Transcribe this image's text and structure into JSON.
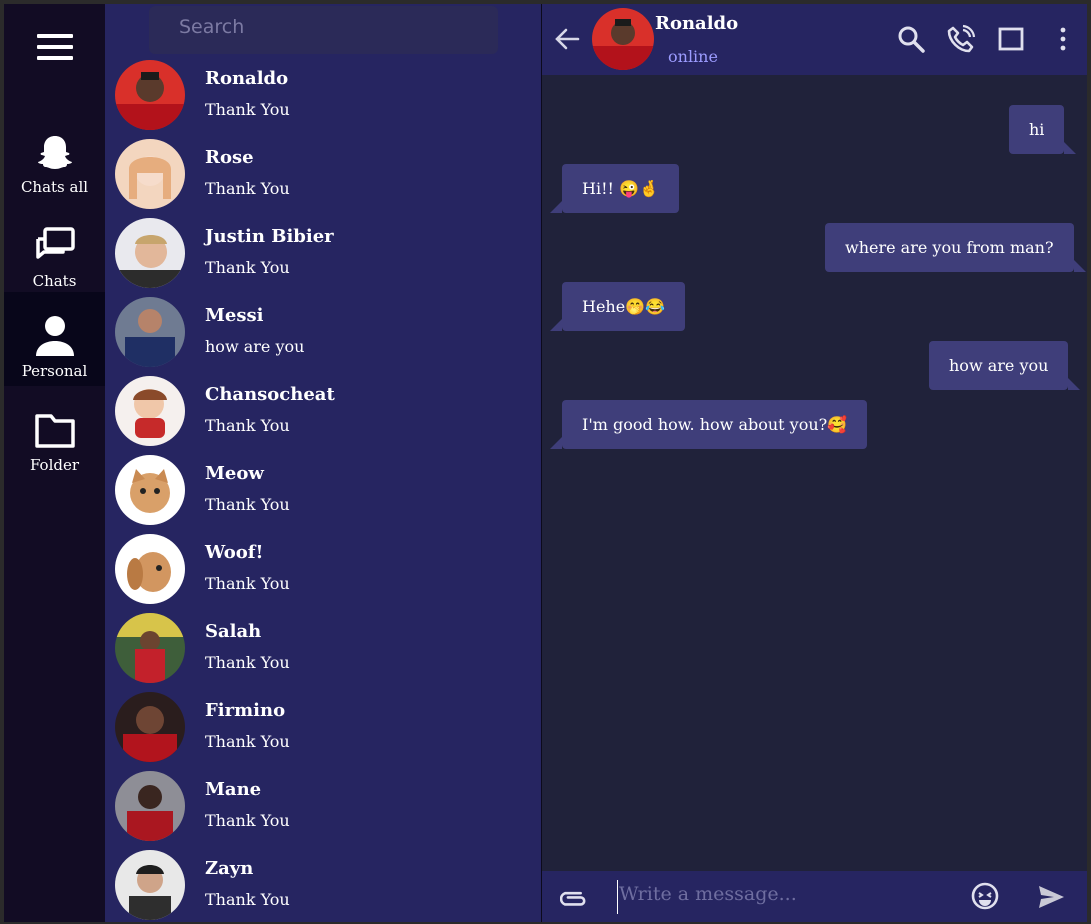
{
  "sidebar": {
    "items": [
      {
        "label": "Chats all",
        "icon": "snapchat-ghost-icon",
        "active": false
      },
      {
        "label": "Chats",
        "icon": "chat-bubbles-icon",
        "active": false
      },
      {
        "label": "Personal",
        "icon": "person-icon",
        "active": true
      },
      {
        "label": "Folder",
        "icon": "folder-icon",
        "active": false
      }
    ]
  },
  "search": {
    "placeholder": "Search"
  },
  "chats": [
    {
      "name": "Ronaldo",
      "last": "Thank You",
      "avatar": "#b3121b"
    },
    {
      "name": "Rose",
      "last": "Thank You",
      "avatar": "#e8b48a"
    },
    {
      "name": "Justin Bibier",
      "last": "Thank You",
      "avatar": "#c5b7a8"
    },
    {
      "name": "Messi",
      "last": "how are you",
      "avatar": "#243a73"
    },
    {
      "name": "Chansocheat",
      "last": "Thank You",
      "avatar": "#f2ece9"
    },
    {
      "name": "Meow",
      "last": "Thank You",
      "avatar": "#d6a06a"
    },
    {
      "name": "Woof!",
      "last": "Thank You",
      "avatar": "#c88a4f"
    },
    {
      "name": "Salah",
      "last": "Thank You",
      "avatar": "#c3212b"
    },
    {
      "name": "Firmino",
      "last": "Thank You",
      "avatar": "#b2141d"
    },
    {
      "name": "Mane",
      "last": "Thank You",
      "avatar": "#aa1720"
    },
    {
      "name": "Zayn",
      "last": "Thank You",
      "avatar": "#3a3a3a"
    }
  ],
  "conversation": {
    "name": "Ronaldo",
    "status": "online",
    "messages": [
      {
        "from": "me",
        "text": "hi"
      },
      {
        "from": "them",
        "text": "Hi!! 😜🤞"
      },
      {
        "from": "me",
        "text": "where are you from man?"
      },
      {
        "from": "them",
        "text": "Hehe🤭😂"
      },
      {
        "from": "me",
        "text": "how are you"
      },
      {
        "from": "them",
        "text": "I'm good how. how about you?🥰"
      }
    ]
  },
  "composer": {
    "placeholder": "Write a message..."
  },
  "colors": {
    "rail": "#120c24",
    "list": "#262561",
    "chat": "#20223a",
    "bubble": "#3f3e7a",
    "status": "#9c9cff"
  }
}
